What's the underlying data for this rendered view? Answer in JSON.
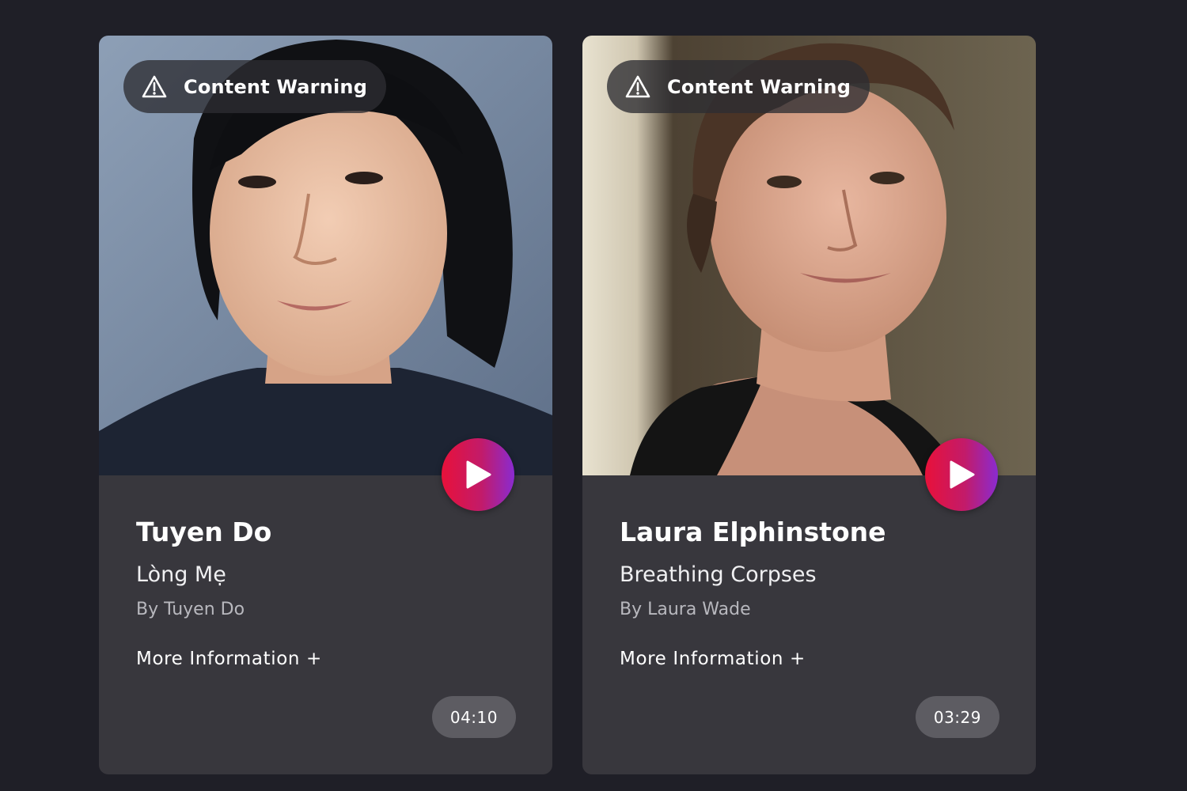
{
  "cards": [
    {
      "warning_label": "Content Warning",
      "name": "Tuyen Do",
      "title": "Lòng Mẹ",
      "author": "By Tuyen Do",
      "more_label": "More Information +",
      "duration": "04:10"
    },
    {
      "warning_label": "Content Warning",
      "name": "Laura Elphinstone",
      "title": "Breathing Corpses",
      "author": "By Laura Wade",
      "more_label": "More Information +",
      "duration": "03:29"
    }
  ],
  "icons": {
    "warning": "warning-triangle-icon",
    "play": "play-icon"
  },
  "colors": {
    "background": "#1f1f27",
    "card": "#38373d",
    "play_gradient_start": "#e8113a",
    "play_gradient_end": "#8a2bd0",
    "duration_badge": "#5d5c62"
  }
}
